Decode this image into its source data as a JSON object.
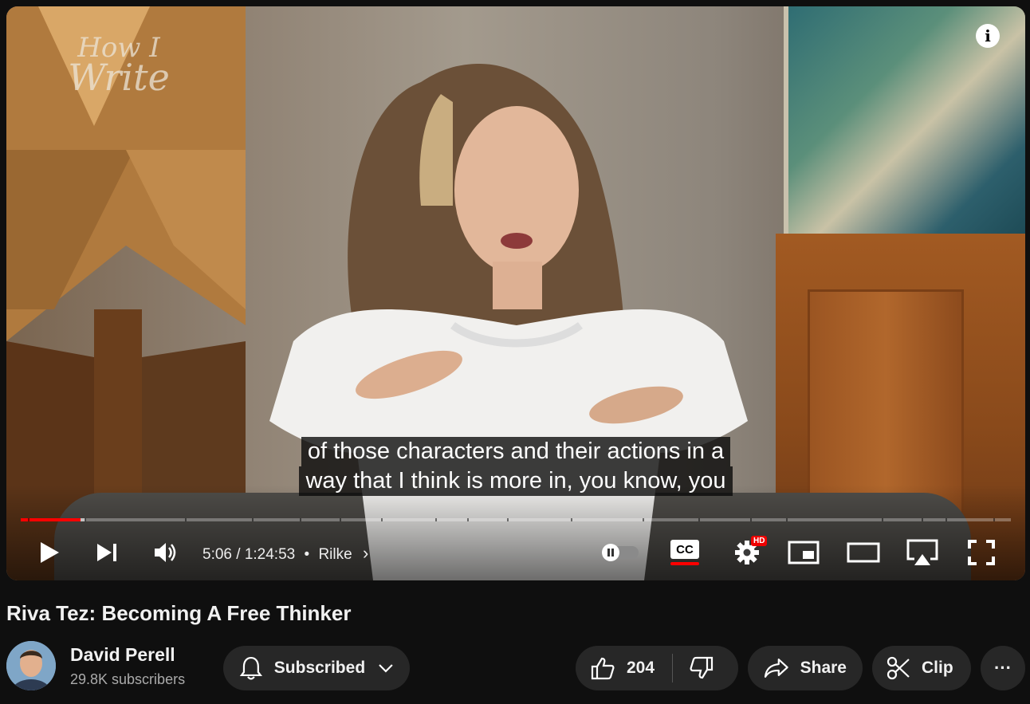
{
  "player": {
    "watermark_line1": "How I",
    "watermark_line2": "Write",
    "caption_line1": "of those characters and their actions in a",
    "caption_line2": "way that I think is more in, you know, you",
    "progress_played_fraction": 0.06,
    "progress_buffered_fraction": 0.065,
    "controls": {
      "play_icon": "play-icon",
      "next_icon": "next-icon",
      "volume_icon": "volume-icon",
      "time_current": "5:06",
      "time_separator": "/",
      "time_total": "1:24:53",
      "dot": "•",
      "chapter": "Rilke",
      "chapter_chevron": "›",
      "autoplay_icon": "autoplay-toggle-icon",
      "cc_label": "CC",
      "settings_badge": "HD",
      "settings_icon": "gear-icon",
      "miniplayer_icon": "miniplayer-icon",
      "theater_icon": "theater-icon",
      "airplay_icon": "airplay-icon",
      "fullscreen_icon": "fullscreen-icon"
    },
    "accent_color": "#ff0000"
  },
  "video": {
    "title": "Riva Tez: Becoming A Free Thinker",
    "channel_name": "David Perell",
    "subscribers": "29.8K subscribers",
    "subscribe_label": "Subscribed",
    "like_count": "204",
    "share_label": "Share",
    "clip_label": "Clip",
    "more_label": "···"
  }
}
